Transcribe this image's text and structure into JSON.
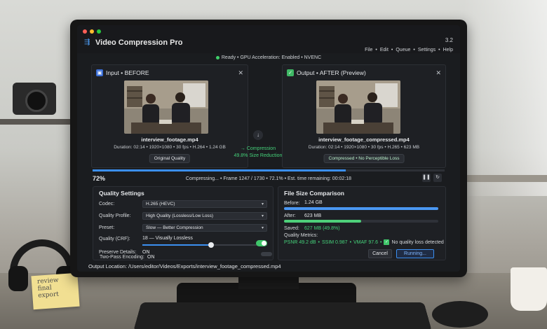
{
  "sticky_note": {
    "lines": [
      "review",
      "final",
      "export"
    ]
  },
  "app": {
    "title": "Video Compression Pro",
    "version": "3.2",
    "menu": [
      "File",
      "Edit",
      "Queue",
      "Settings",
      "Help"
    ],
    "status": "Ready • GPU Acceleration: Enabled • NVENC"
  },
  "input_panel": {
    "title": "Input • BEFORE",
    "close": "✕",
    "file_name": "interview_footage.mp4",
    "meta": "Duration: 02:14 • 1920×1080 • 30 fps • H.264 • 1.24 GB",
    "badge": "Original Quality"
  },
  "output_panel": {
    "title": "Output • AFTER (Preview)",
    "close": "✕",
    "file_name": "interview_footage_compressed.mp4",
    "meta": "Duration: 02:14 • 1920×1080 • 30 fps • H.265 • 623 MB",
    "badge": "Compressed • No Perceptible Loss"
  },
  "compression": {
    "arrow": "↓",
    "label": "→ Compression",
    "reduction": "49.8% Size Reduction"
  },
  "progress": {
    "percent_label": "72%",
    "value": 0.72,
    "text": "Compressing... • Frame 1247 / 1730 • 72.1% • Est. time remaining: 00:02:18",
    "pause": "❚❚",
    "refresh": "↻"
  },
  "quality": {
    "title": "Quality Settings",
    "codec_label": "Codec:",
    "codec_value": "H.265 (HEVC)",
    "profile_label": "Quality Profile:",
    "profile_value": "High Quality (Lossless/Low Loss)",
    "preset_label": "Preset:",
    "preset_value": "Slow — Better Compression",
    "crf_label": "Quality (CRF):",
    "crf_value": "18 — Visually Lossless",
    "preserve_label": "Preserve Details:",
    "preserve_value": "ON",
    "twopass_label": "Two-Pass Encoding:",
    "twopass_value": "ON",
    "chevron": "▾"
  },
  "file_size": {
    "title": "File Size Comparison",
    "before_label": "Before:",
    "before_value": "1.24 GB",
    "before_fill": 1.0,
    "after_label": "After:",
    "after_value": "623 MB",
    "after_fill": 0.502,
    "saved_label": "Saved:",
    "saved_value": "627 MB (49.8%)",
    "metrics_label": "Quality Metrics:",
    "psnr": "PSNR 49.2 dB",
    "ssim": "SSIM 0.987",
    "vmaf": "VMAF 97.6",
    "separator": "•",
    "check": "✓",
    "no_loss": "No quality loss detected",
    "cancel": "Cancel",
    "running": "Running..."
  },
  "output_location": "Output Location: /Users/editor/Videos/Exports/interview_footage_compressed.mp4",
  "colors": {
    "accent": "#3b8ff0",
    "success": "#45d27a",
    "before_bar": "#4a97f2",
    "after_bar": "#4ed07a"
  }
}
